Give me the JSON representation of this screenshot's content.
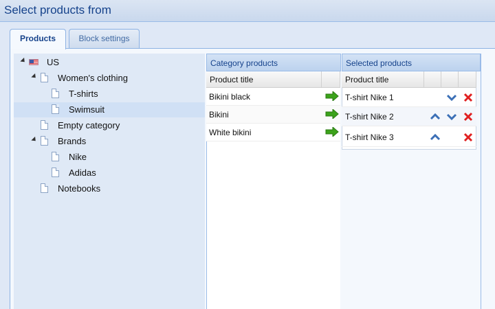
{
  "window": {
    "title": "Select products from"
  },
  "tabs": [
    {
      "label": "Products",
      "active": true
    },
    {
      "label": "Block settings",
      "active": false
    }
  ],
  "tree": [
    {
      "label": "US",
      "level": 0,
      "icon": "us-flag-icon",
      "expanded": true
    },
    {
      "label": "Women's clothing",
      "level": 1,
      "icon": "document-icon",
      "expanded": true
    },
    {
      "label": "T-shirts",
      "level": 2,
      "icon": "document-icon"
    },
    {
      "label": "Swimsuit",
      "level": 2,
      "icon": "document-icon",
      "selected": true
    },
    {
      "label": "Empty category",
      "level": 1,
      "icon": "document-icon"
    },
    {
      "label": "Brands",
      "level": 1,
      "icon": "document-icon",
      "expanded": true
    },
    {
      "label": "Nike",
      "level": 2,
      "icon": "document-icon"
    },
    {
      "label": "Adidas",
      "level": 2,
      "icon": "document-icon"
    },
    {
      "label": "Notebooks",
      "level": 1,
      "icon": "document-icon"
    }
  ],
  "category_products": {
    "header": "Category products",
    "column": "Product title",
    "rows": [
      "Bikini black",
      "Bikini",
      "White bikini"
    ]
  },
  "selected_products": {
    "header": "Selected products",
    "column": "Product title",
    "rows": [
      {
        "title": "T-shirt Nike 1",
        "up": false,
        "down": true
      },
      {
        "title": "T-shirt Nike 2",
        "up": true,
        "down": true
      },
      {
        "title": "T-shirt Nike 3",
        "up": true,
        "down": false
      }
    ]
  },
  "colors": {
    "accent": "#15428b",
    "add": "#3ca31b",
    "remove": "#e02020",
    "move": "#3b6fb6"
  }
}
